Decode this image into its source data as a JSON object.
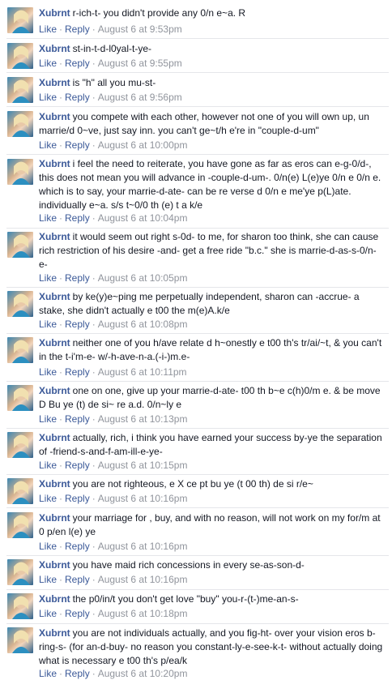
{
  "comments": [
    {
      "author": "Xubrnt",
      "text": "r-ich-t- you didn't provide any 0/n e~a. R",
      "timestamp": "August 6 at 9:53pm",
      "like": "Like",
      "reply": "Reply"
    },
    {
      "author": "Xubrnt",
      "text": "st-in-t-d-l0yal-t-ye-",
      "timestamp": "August 6 at 9:55pm",
      "like": "Like",
      "reply": "Reply"
    },
    {
      "author": "Xubrnt",
      "text": "is \"h\" all you mu-st-",
      "timestamp": "August 6 at 9:56pm",
      "like": "Like",
      "reply": "Reply"
    },
    {
      "author": "Xubrnt",
      "text": "you compete with each other, however not one of you will own up, un marrie/d 0~ve, just say inn. you can't ge~t/h e're in \"couple-d-um\"",
      "timestamp": "August 6 at 10:00pm",
      "like": "Like",
      "reply": "Reply"
    },
    {
      "author": "Xubrnt",
      "text": "i feel the need to reiterate, you have gone as far as eros can e-g-0/d-, this does not mean you will advance in -couple-d-um-. 0/n(e) L(e)ye 0/n e 0/n e. which is to say, your marrie-d-ate- can be re verse d 0/n e me'ye p(L)ate. individually e~a. s/s t~0/0 th (e) t a k/e",
      "timestamp": "August 6 at 10:04pm",
      "like": "Like",
      "reply": "Reply"
    },
    {
      "author": "Xubrnt",
      "text": "it would seem out right s-0d- to me, for sharon too think, she can cause rich restriction of his desire -and- get a free ride \"b.c.\" she is marrie-d-as-s-0/n-e-",
      "timestamp": "August 6 at 10:05pm",
      "like": "Like",
      "reply": "Reply"
    },
    {
      "author": "Xubrnt",
      "text": "by ke(y)e~ping me perpetually independent, sharon can -accrue- a stake, she didn't actually e t00 the m(e)A.k/e",
      "timestamp": "August 6 at 10:08pm",
      "like": "Like",
      "reply": "Reply"
    },
    {
      "author": "Xubrnt",
      "text": "neither one of you h/ave relate d h~onestly e t00 th's tr/ai/~t, & you can't in the t-i'm-e- w/-h-ave-n-a.(-i-)m.e-",
      "timestamp": "August 6 at 10:11pm",
      "like": "Like",
      "reply": "Reply"
    },
    {
      "author": "Xubrnt",
      "text": "one on one, give up your marrie-d-ate- t00 th b~e c(h)0/m e. & be move D Bu ye (t) de si~ re a.d. 0/n~ly e",
      "timestamp": "August 6 at 10:13pm",
      "like": "Like",
      "reply": "Reply"
    },
    {
      "author": "Xubrnt",
      "text": "actually, rich, i think you have earned your success by-ye the separation of -friend-s-and-f-am-ill-e-ye-",
      "timestamp": "August 6 at 10:15pm",
      "like": "Like",
      "reply": "Reply"
    },
    {
      "author": "Xubrnt",
      "text": "you are not righteous, e X ce pt bu ye (t 00 th) de si r/e~",
      "timestamp": "August 6 at 10:16pm",
      "like": "Like",
      "reply": "Reply"
    },
    {
      "author": "Xubrnt",
      "text": "your marriage for , buy, and with no reason, will not work on my for/m at 0 p/en l(e) ye",
      "timestamp": "August 6 at 10:16pm",
      "like": "Like",
      "reply": "Reply"
    },
    {
      "author": "Xubrnt",
      "text": "you have maid rich concessions in every se-as-son-d-",
      "timestamp": "August 6 at 10:16pm",
      "like": "Like",
      "reply": "Reply"
    },
    {
      "author": "Xubrnt",
      "text": "the p0/in/t you don't get love \"buy\" you-r-(t-)me-an-s-",
      "timestamp": "August 6 at 10:18pm",
      "like": "Like",
      "reply": "Reply"
    },
    {
      "author": "Xubrnt",
      "text": "you are not individuals actually, and you fig-ht- over your vision eros b-ring-s- (for an-d-buy- no reason you constant-ly-e-see-k-t- without actually doing what is necessary e t00 th's p/ea/k",
      "timestamp": "August 6 at 10:20pm",
      "like": "Like",
      "reply": "Reply"
    }
  ]
}
